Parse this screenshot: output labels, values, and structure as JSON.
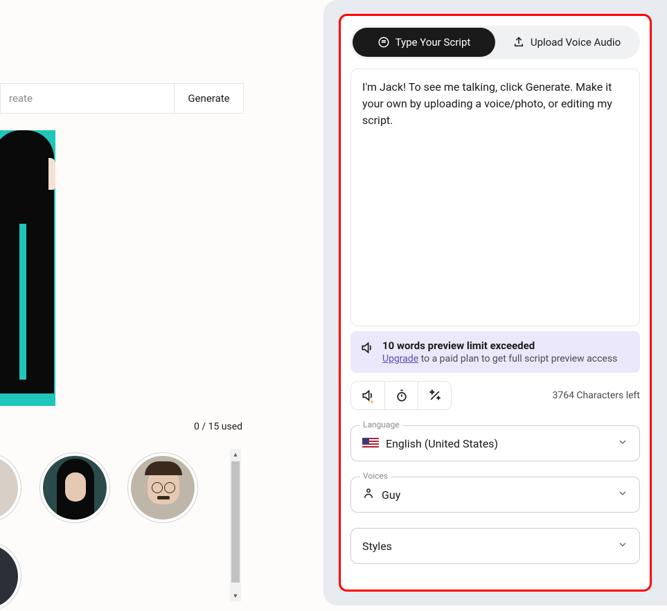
{
  "left": {
    "topbar_left": "reate",
    "generate_label": "Generate",
    "usage_text": "0 / 15 used"
  },
  "tabs": {
    "type_script_label": "Type Your Script",
    "upload_voice_label": "Upload Voice Audio"
  },
  "script": {
    "value": "I'm Jack! To see me talking, click Generate. Make it your own by uploading a voice/photo, or editing my script."
  },
  "banner": {
    "title": "10 words preview limit exceeded",
    "upgrade_label": "Upgrade",
    "tail": " to a paid plan to get full script preview access"
  },
  "footer": {
    "chars_left": "3764 Characters left"
  },
  "language": {
    "legend": "Language",
    "value": "English (United States)"
  },
  "voices": {
    "legend": "Voices",
    "value": "Guy"
  },
  "styles": {
    "value": "Styles"
  }
}
